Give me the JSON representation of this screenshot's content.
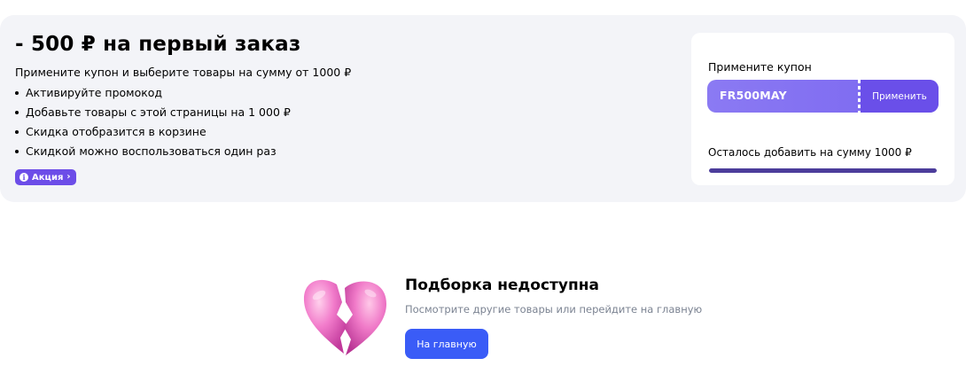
{
  "promo": {
    "title": "- 500 ₽ на первый заказ",
    "subtitle": "Примените купон и выберите товары на сумму от 1000 ₽",
    "steps": [
      "Активируйте промокод",
      "Добавьте товары с этой страницы на 1 000 ₽",
      "Скидка отобразится в корзине",
      "Скидкой можно воспользоваться один раз"
    ],
    "badge": {
      "icon": "info-icon",
      "label": "Акция",
      "chevron": "›",
      "icon_glyph": "i"
    },
    "accent_color": "#6c4de8",
    "panel_color": "#f3f4f8"
  },
  "coupon": {
    "heading": "Примените купон",
    "code": "FR500MAY",
    "apply_label": "Применить",
    "remaining_text": "Осталось добавить на сумму 1000 ₽",
    "progress": 1.0,
    "ticket_color": "#7a66f0",
    "progress_color": "#4c3d9b"
  },
  "empty_state": {
    "icon": "broken-heart-icon",
    "title": "Подборка недоступна",
    "subtitle": "Посмотрите другие товары или перейдите на главную",
    "button_label": "На главную",
    "button_color": "#3a5cf7"
  }
}
